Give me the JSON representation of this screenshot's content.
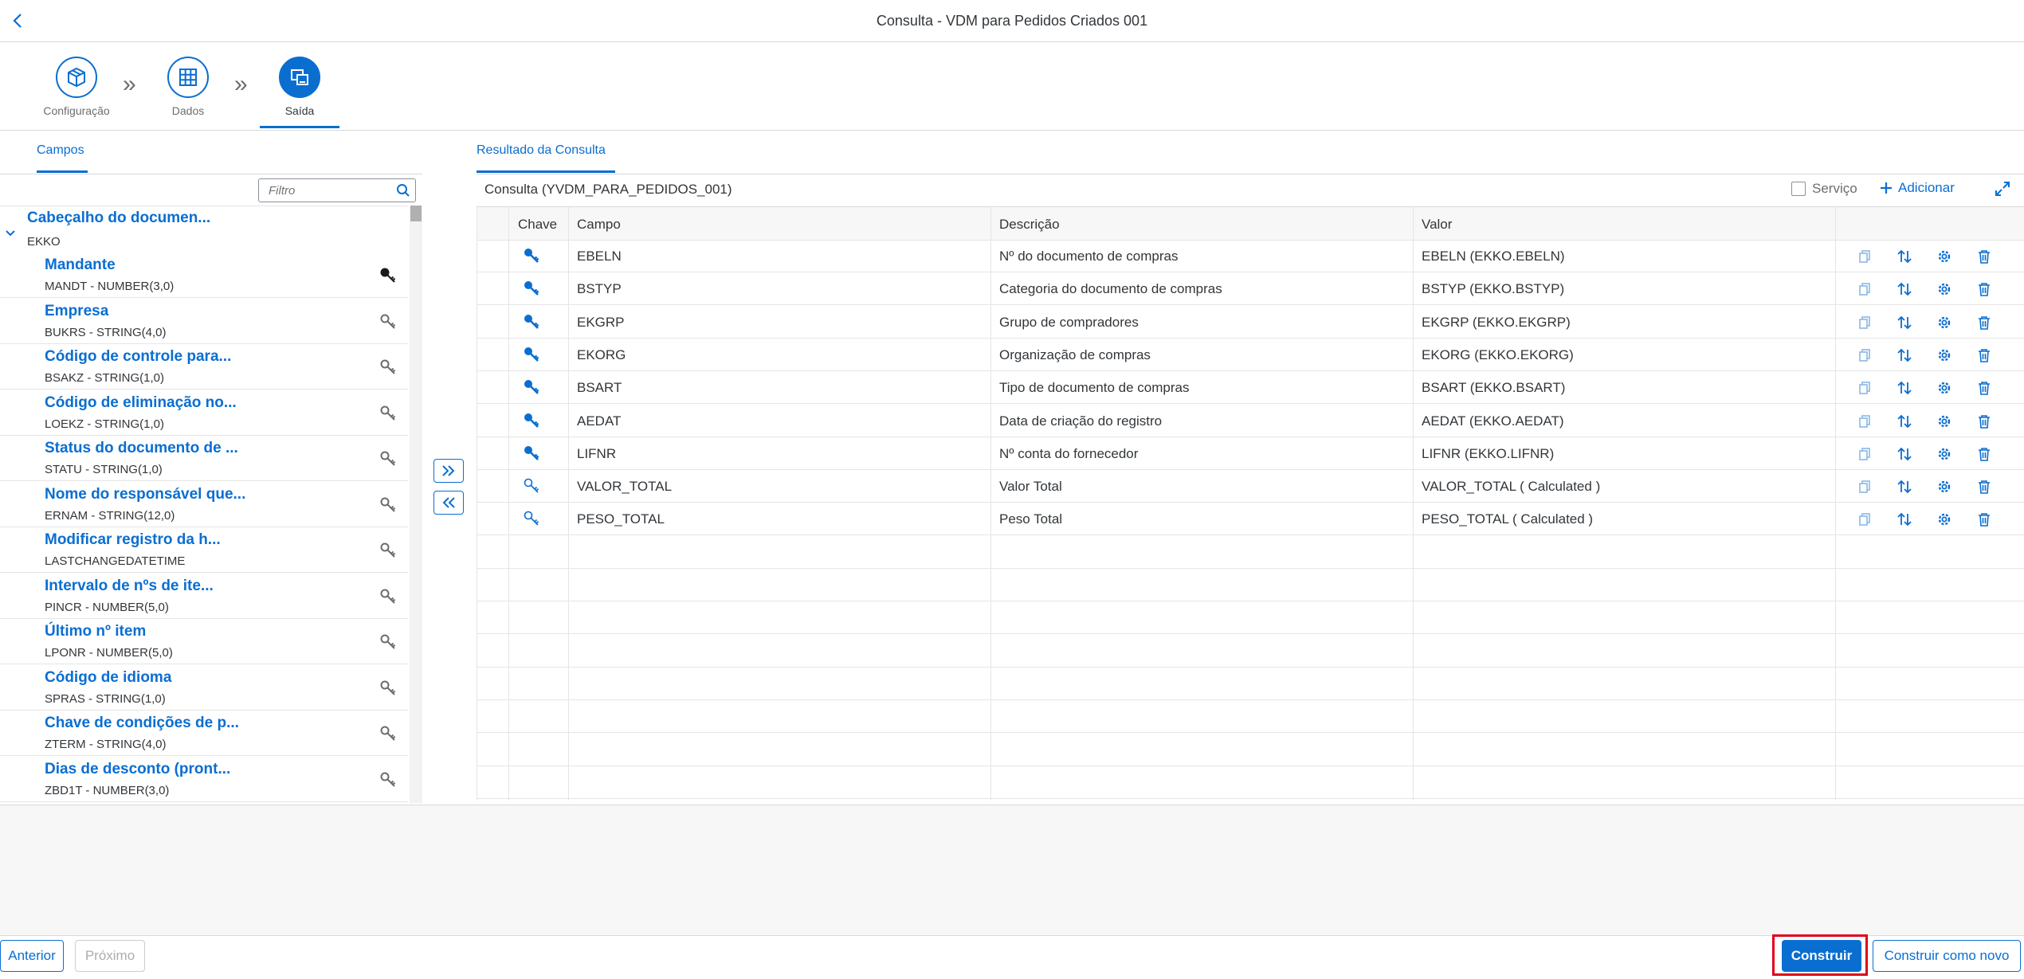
{
  "shell": {
    "title": "Consulta - VDM para Pedidos Criados 001"
  },
  "wizard": {
    "steps": [
      {
        "label": "Configuração"
      },
      {
        "label": "Dados"
      },
      {
        "label": "Saída"
      }
    ]
  },
  "tabs": {
    "left": "Campos",
    "right": "Resultado da Consulta"
  },
  "left": {
    "filter_placeholder": "Filtro",
    "group": {
      "title": "Cabeçalho do documen...",
      "subtitle": "EKKO"
    },
    "fields": [
      {
        "title": "Mandante",
        "type": "MANDT - NUMBER(3,0)",
        "key": true
      },
      {
        "title": "Empresa",
        "type": "BUKRS - STRING(4,0)",
        "key": false
      },
      {
        "title": "Código de controle para...",
        "type": "BSAKZ - STRING(1,0)",
        "key": false
      },
      {
        "title": "Código de eliminação no...",
        "type": "LOEKZ - STRING(1,0)",
        "key": false
      },
      {
        "title": "Status do documento de ...",
        "type": "STATU - STRING(1,0)",
        "key": false
      },
      {
        "title": "Nome do responsável que...",
        "type": "ERNAM - STRING(12,0)",
        "key": false
      },
      {
        "title": "Modificar registro da h...",
        "type": "LASTCHANGEDATETIME",
        "key": false
      },
      {
        "title": "Intervalo de nºs de ite...",
        "type": "PINCR - NUMBER(5,0)",
        "key": false
      },
      {
        "title": "Último nº item",
        "type": "LPONR - NUMBER(5,0)",
        "key": false
      },
      {
        "title": "Código de idioma",
        "type": "SPRAS - STRING(1,0)",
        "key": false
      },
      {
        "title": "Chave de condições de p...",
        "type": "ZTERM - STRING(4,0)",
        "key": false
      },
      {
        "title": "Dias de desconto (pront...",
        "type": "ZBD1T - NUMBER(3,0)",
        "key": false
      }
    ]
  },
  "query": {
    "title": "Consulta (YVDM_PARA_PEDIDOS_001)",
    "servico_label": "Serviço",
    "adicionar_label": "Adicionar",
    "columns": [
      "Chave",
      "Campo",
      "Descrição",
      "Valor"
    ],
    "rows": [
      {
        "key": true,
        "campo": "EBELN",
        "descricao": "Nº do documento de compras",
        "valor": "EBELN (EKKO.EBELN)"
      },
      {
        "key": true,
        "campo": "BSTYP",
        "descricao": "Categoria do documento de compras",
        "valor": "BSTYP (EKKO.BSTYP)"
      },
      {
        "key": true,
        "campo": "EKGRP",
        "descricao": "Grupo de compradores",
        "valor": "EKGRP (EKKO.EKGRP)"
      },
      {
        "key": true,
        "campo": "EKORG",
        "descricao": "Organização de compras",
        "valor": "EKORG (EKKO.EKORG)"
      },
      {
        "key": true,
        "campo": "BSART",
        "descricao": "Tipo de documento de compras",
        "valor": "BSART (EKKO.BSART)"
      },
      {
        "key": true,
        "campo": "AEDAT",
        "descricao": "Data de criação do registro",
        "valor": "AEDAT (EKKO.AEDAT)"
      },
      {
        "key": true,
        "campo": "LIFNR",
        "descricao": "Nº conta do fornecedor",
        "valor": "LIFNR (EKKO.LIFNR)"
      },
      {
        "key": false,
        "campo": "VALOR_TOTAL",
        "descricao": "Valor Total",
        "valor": "VALOR_TOTAL ( Calculated )"
      },
      {
        "key": false,
        "campo": "PESO_TOTAL",
        "descricao": "Peso Total",
        "valor": "PESO_TOTAL ( Calculated )"
      }
    ]
  },
  "footer": {
    "anterior": "Anterior",
    "proximo": "Próximo",
    "construir": "Construir",
    "construir_novo": "Construir como novo"
  },
  "colors": {
    "accent": "#0a6ed1",
    "highlight": "#e0001b"
  }
}
